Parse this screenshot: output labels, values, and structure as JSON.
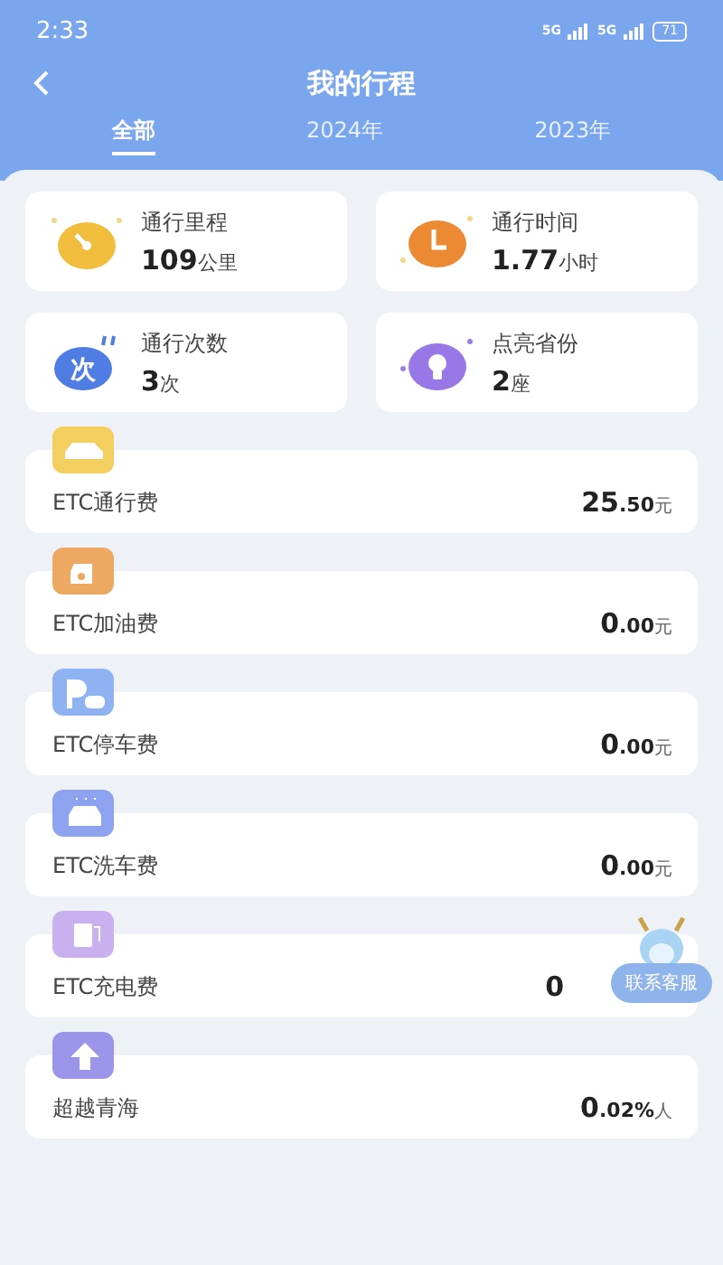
{
  "status_bar": {
    "time": "2:33",
    "network_1": "5G",
    "network_2": "5G",
    "battery": "71"
  },
  "header": {
    "title": "我的行程"
  },
  "tabs": [
    {
      "label": "全部",
      "selected": true
    },
    {
      "label": "2024年",
      "selected": false
    },
    {
      "label": "2023年",
      "selected": false
    }
  ],
  "stats": [
    {
      "kind": "gauge",
      "label": "通行里程",
      "value": "109",
      "unit": "公里"
    },
    {
      "kind": "clock",
      "label": "通行时间",
      "value": "1.77",
      "unit": "小时"
    },
    {
      "kind": "count",
      "label": "通行次数",
      "value": "3",
      "unit": "次",
      "icon_text": "次"
    },
    {
      "kind": "bulb",
      "label": "点亮省份",
      "value": "2",
      "unit": "座"
    }
  ],
  "fees": [
    {
      "kind": "car",
      "label": "ETC通行费",
      "amount": "25",
      "decimal": ".50",
      "unit": "元",
      "color": "#f2cf5f"
    },
    {
      "kind": "fuel",
      "label": "ETC加油费",
      "amount": "0",
      "decimal": ".00",
      "unit": "元",
      "color": "#eda862"
    },
    {
      "kind": "parking",
      "label": "ETC停车费",
      "amount": "0",
      "decimal": ".00",
      "unit": "元",
      "color": "#8fb2f2"
    },
    {
      "kind": "wash",
      "label": "ETC洗车费",
      "amount": "0",
      "decimal": ".00",
      "unit": "元",
      "color": "#8ea3ef"
    },
    {
      "kind": "charge",
      "label": "ETC充电费",
      "amount": "0",
      "color": "#c8b1ee"
    },
    {
      "kind": "rank",
      "label": "超越青海",
      "amount": "0",
      "decimal": ".02%",
      "unit": "人",
      "color": "#9b95ea"
    }
  ],
  "support_button": {
    "label": "联系客服"
  }
}
